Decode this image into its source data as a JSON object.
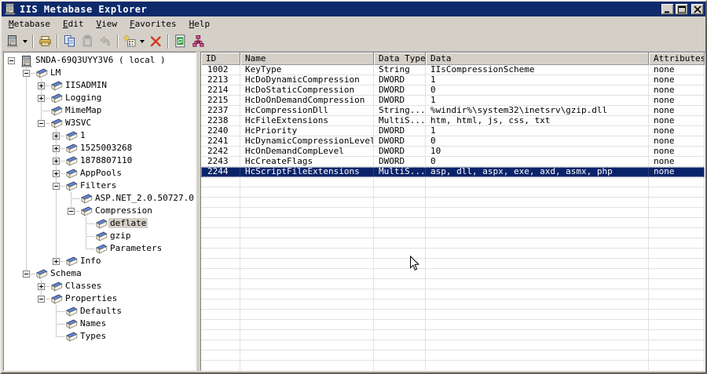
{
  "window": {
    "title": "IIS Metabase Explorer",
    "controls": {
      "minimize": "minimize",
      "maximize": "maximize",
      "close": "close"
    }
  },
  "colors": {
    "titlebar": "#0d2a6b",
    "titlebar_text": "#ffffff",
    "face": "#d4d0c8",
    "selection": "#0a246a",
    "selection_text": "#ffffff",
    "panel_bg": "#ffffff",
    "grid_line": "#e4e2dd",
    "delete_red": "#d23b23",
    "refresh_green": "#2f9e3a",
    "tree_icon_blue": "#5b87d6"
  },
  "menu": {
    "items": [
      {
        "label": "Metabase",
        "underline": 0
      },
      {
        "label": "Edit",
        "underline": 0
      },
      {
        "label": "View",
        "underline": 0
      },
      {
        "label": "Favorites",
        "underline": 0
      },
      {
        "label": "Help",
        "underline": 0
      }
    ]
  },
  "toolbar": {
    "buttons": [
      {
        "name": "connect-computer",
        "icon": "computer",
        "dropdown": true,
        "separator_after": true
      },
      {
        "name": "print",
        "icon": "print",
        "separator_after": true
      },
      {
        "name": "copy",
        "icon": "copy"
      },
      {
        "name": "paste",
        "icon": "paste",
        "disabled": true
      },
      {
        "name": "undo",
        "icon": "undo",
        "disabled": true,
        "separator_after": true
      },
      {
        "name": "new-key",
        "icon": "newkey",
        "dropdown": true
      },
      {
        "name": "delete",
        "icon": "delete",
        "separator_after": true
      },
      {
        "name": "refresh",
        "icon": "refresh"
      },
      {
        "name": "tree-view",
        "icon": "treeview"
      }
    ]
  },
  "tree": {
    "root": {
      "label": "SNDA-69Q3UYY3V6 ( local )",
      "icon": "computer",
      "exp": "minus",
      "children": [
        {
          "label": "LM",
          "exp": "minus",
          "children": [
            {
              "label": "IISADMIN",
              "exp": "plus",
              "children": []
            },
            {
              "label": "Logging",
              "exp": "plus",
              "children": []
            },
            {
              "label": "MimeMap",
              "exp": null,
              "children": []
            },
            {
              "label": "W3SVC",
              "exp": "minus",
              "children": [
                {
                  "label": "1",
                  "exp": "plus",
                  "children": []
                },
                {
                  "label": "1525003268",
                  "exp": "plus",
                  "children": []
                },
                {
                  "label": "1878807110",
                  "exp": "plus",
                  "children": []
                },
                {
                  "label": "AppPools",
                  "exp": "plus",
                  "children": []
                },
                {
                  "label": "Filters",
                  "exp": "minus",
                  "children": [
                    {
                      "label": "ASP.NET_2.0.50727.0",
                      "exp": null,
                      "children": []
                    },
                    {
                      "label": "Compression",
                      "exp": "minus",
                      "children": [
                        {
                          "label": "deflate",
                          "exp": null,
                          "selected": true,
                          "children": []
                        },
                        {
                          "label": "gzip",
                          "exp": null,
                          "children": []
                        },
                        {
                          "label": "Parameters",
                          "exp": null,
                          "children": []
                        }
                      ]
                    }
                  ]
                },
                {
                  "label": "Info",
                  "exp": "plus",
                  "children": []
                }
              ]
            }
          ]
        },
        {
          "label": "Schema",
          "exp": "minus",
          "children": [
            {
              "label": "Classes",
              "exp": "plus",
              "children": []
            },
            {
              "label": "Properties",
              "exp": "minus",
              "children": [
                {
                  "label": "Defaults",
                  "exp": null,
                  "children": []
                },
                {
                  "label": "Names",
                  "exp": null,
                  "children": []
                },
                {
                  "label": "Types",
                  "exp": null,
                  "children": []
                }
              ]
            }
          ]
        }
      ]
    }
  },
  "grid": {
    "columns": [
      "ID",
      "Name",
      "Data Type",
      "Data",
      "Attributes"
    ],
    "rows": [
      {
        "id": "1002",
        "name": "KeyType",
        "data_type": "String",
        "data": "IIsCompressionScheme",
        "attributes": "none"
      },
      {
        "id": "2213",
        "name": "HcDoDynamicCompression",
        "data_type": "DWORD",
        "data": "1",
        "attributes": "none"
      },
      {
        "id": "2214",
        "name": "HcDoStaticCompression",
        "data_type": "DWORD",
        "data": "0",
        "attributes": "none"
      },
      {
        "id": "2215",
        "name": "HcDoOnDemandCompression",
        "data_type": "DWORD",
        "data": "1",
        "attributes": "none"
      },
      {
        "id": "2237",
        "name": "HcCompressionDll",
        "data_type": "String...",
        "data": "%windir%\\system32\\inetsrv\\gzip.dll",
        "attributes": "none"
      },
      {
        "id": "2238",
        "name": "HcFileExtensions",
        "data_type": "MultiS...",
        "data": "htm, html, js, css, txt",
        "attributes": "none"
      },
      {
        "id": "2240",
        "name": "HcPriority",
        "data_type": "DWORD",
        "data": "1",
        "attributes": "none"
      },
      {
        "id": "2241",
        "name": "HcDynamicCompressionLevel",
        "data_type": "DWORD",
        "data": "0",
        "attributes": "none"
      },
      {
        "id": "2242",
        "name": "HcOnDemandCompLevel",
        "data_type": "DWORD",
        "data": "10",
        "attributes": "none"
      },
      {
        "id": "2243",
        "name": "HcCreateFlags",
        "data_type": "DWORD",
        "data": "0",
        "attributes": "none"
      },
      {
        "id": "2244",
        "name": "HcScriptFileExtensions",
        "data_type": "MultiS...",
        "data": "asp, dll, aspx, exe, axd, asmx, php",
        "attributes": "none",
        "selected": true
      }
    ]
  }
}
